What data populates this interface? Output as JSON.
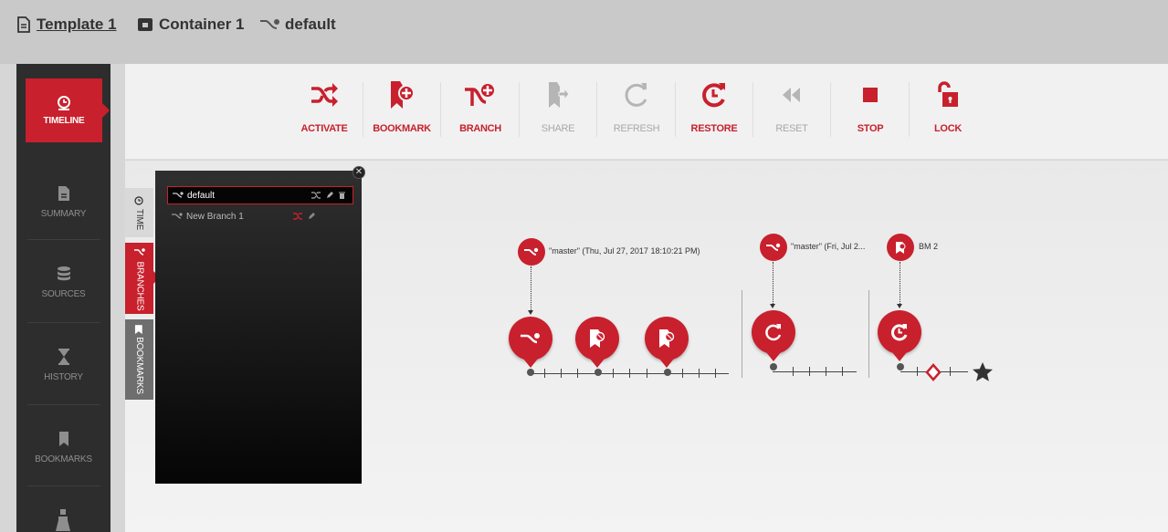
{
  "breadcrumb": {
    "template": "Template 1",
    "container": "Container 1",
    "branch": "default"
  },
  "sidebar": {
    "items": [
      {
        "label": "TIMELINE",
        "icon": "clock-icon",
        "active": true
      },
      {
        "label": "SUMMARY",
        "icon": "document-icon"
      },
      {
        "label": "SOURCES",
        "icon": "database-icon"
      },
      {
        "label": "HISTORY",
        "icon": "hourglass-icon"
      },
      {
        "label": "BOOKMARKS",
        "icon": "bookmark-icon"
      }
    ]
  },
  "toolbar": {
    "activate": "ACTIVATE",
    "bookmark": "BOOKMARK",
    "branch": "BRANCH",
    "share": "SHARE",
    "refresh": "REFRESH",
    "restore": "RESTORE",
    "reset": "RESET",
    "stop": "STOP",
    "lock": "LOCK"
  },
  "tabs": {
    "time": "TIME",
    "branches": "BRANCHES",
    "bookmarks": "BOOKMARKS"
  },
  "branches": [
    {
      "name": "default",
      "selected": true
    },
    {
      "name": "New Branch 1",
      "selected": false
    }
  ],
  "timeline": {
    "captions": {
      "segment1": "\"master\" (Thu, Jul 27, 2017 18:10:21 PM)",
      "segment2": "\"master\" (Fri, Jul 2...",
      "segment3": "BM 2"
    }
  },
  "colors": {
    "accent": "#c8202d",
    "sidebar": "#2d2d2d",
    "disabled": "#a8a8a8"
  }
}
